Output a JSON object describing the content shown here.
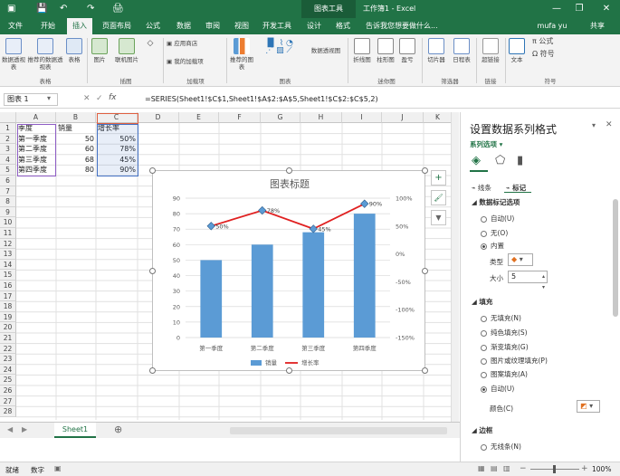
{
  "title_bar": {
    "chart_tools": "图表工具",
    "window_title": "工作簿1 - Excel",
    "minimize": "—",
    "restore": "❐",
    "close": "✕"
  },
  "tabs": [
    "文件",
    "开始",
    "插入",
    "页面布局",
    "公式",
    "数据",
    "审阅",
    "视图",
    "开发工具",
    "设计",
    "格式"
  ],
  "tell_me": "告诉我您想要做什么...",
  "user": "mufa yu",
  "share": "共享",
  "ribbon": {
    "buttons": [
      "数据透视表",
      "推荐的数据透视表",
      "表格",
      "图片",
      "联机图片",
      "推荐的图表",
      "折线图",
      "柱形图",
      "盈亏",
      "切片器",
      "日程表",
      "超链接",
      "文本",
      "符号"
    ],
    "small_buttons": [
      "应用商店",
      "我的加载项",
      "数据透视图",
      "公式",
      "符号"
    ],
    "groups": [
      "表格",
      "插图",
      "加载项",
      "图表",
      "迷你图",
      "筛选器",
      "链接",
      "符号"
    ]
  },
  "formula_bar": {
    "name_box": "图表 1",
    "fx": "fx",
    "formula": "=SERIES(Sheet1!$C$1,Sheet1!$A$2:$A$5,Sheet1!$C$2:$C$5,2)"
  },
  "columns": [
    "A",
    "B",
    "C",
    "D",
    "E",
    "F",
    "G",
    "H",
    "I",
    "J",
    "K"
  ],
  "rows": [
    "1",
    "2",
    "3",
    "4",
    "5",
    "6",
    "7",
    "8",
    "9",
    "10",
    "11",
    "12",
    "13",
    "14",
    "15",
    "16",
    "17",
    "18",
    "19",
    "20",
    "21",
    "22",
    "23",
    "24",
    "25",
    "26",
    "27",
    "28"
  ],
  "sheet_cells": {
    "header": [
      "季度",
      "销量",
      "增长率"
    ],
    "data": [
      [
        "第一季度",
        "50",
        "50%"
      ],
      [
        "第二季度",
        "60",
        "78%"
      ],
      [
        "第三季度",
        "68",
        "45%"
      ],
      [
        "第四季度",
        "80",
        "90%"
      ]
    ]
  },
  "chart_data": {
    "type": "bar",
    "title": "图表标题",
    "categories": [
      "第一季度",
      "第二季度",
      "第三季度",
      "第四季度"
    ],
    "series": [
      {
        "name": "销量",
        "type": "bar",
        "axis": "left",
        "values": [
          50,
          60,
          68,
          80
        ],
        "color": "#5b9bd5"
      },
      {
        "name": "增长率",
        "type": "line",
        "axis": "right",
        "values": [
          0.5,
          0.78,
          0.45,
          0.9
        ],
        "labels": [
          "50%",
          "78%",
          "45%",
          "90%"
        ],
        "color": "#e02020"
      }
    ],
    "y_left": {
      "min": 0,
      "max": 90,
      "ticks": [
        "0",
        "10",
        "20",
        "30",
        "40",
        "50",
        "60",
        "70",
        "80",
        "90"
      ]
    },
    "y_right": {
      "min": -1.5,
      "max": 1.0,
      "ticks": [
        "-150%",
        "-100%",
        "-50%",
        "0%",
        "50%",
        "100%"
      ]
    },
    "legend": "bottom",
    "grid": true
  },
  "chart_buttons": {
    "add": "+",
    "style": "🖌",
    "filter": "▼"
  },
  "format_pane": {
    "title": "设置数据系列格式",
    "series_options": "系列选项",
    "tabs": [
      "线条",
      "标记"
    ],
    "section_marker_options": "数据标记选项",
    "marker_options": [
      "自动(U)",
      "无(O)",
      "内置"
    ],
    "type_label": "类型",
    "size_label": "大小",
    "size_value": "5",
    "section_fill": "填充",
    "fill_options": [
      "无填充(N)",
      "纯色填充(S)",
      "渐变填充(G)",
      "图片或纹理填充(P)",
      "图案填充(A)",
      "自动(U)"
    ],
    "color_label": "颜色(C)",
    "section_border": "边框",
    "border_options": [
      "无线条(N)"
    ]
  },
  "sheet_tab": "Sheet1",
  "status": {
    "ready": "就绪",
    "numlock": "数字",
    "zoom": "100%"
  }
}
